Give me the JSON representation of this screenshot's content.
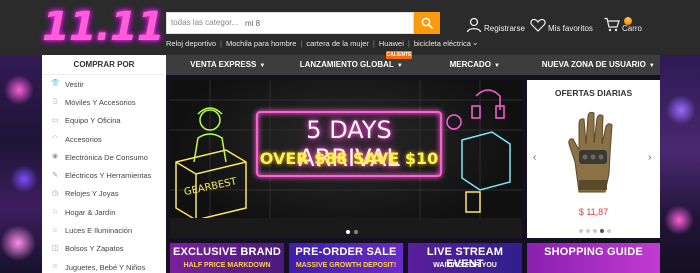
{
  "logo": {
    "text": "11.11"
  },
  "search": {
    "category": "todas las categor...",
    "value": "mi 8",
    "button_icon": "search-icon"
  },
  "hot_words": [
    "Reloj deportivo",
    "Mochila para hombre",
    "cartera de la mujer",
    "Huawei",
    "bicicleta eléctrica"
  ],
  "header_actions": {
    "register": "Registrarse",
    "favorites": "Mis favoritos",
    "cart": "Carro",
    "cart_count": "0"
  },
  "categories": {
    "title": "COMPRAR POR",
    "items": [
      "Vestir",
      "Móviles Y Accesorios",
      "Equipo Y Oficina",
      "Accesorios",
      "Electrónica De Consumo",
      "Eléctricos Y Herramientas",
      "Relojes Y Joyas",
      "Hogar & Jardín",
      "Luces E Iluminación",
      "Bolsos Y Zapatos",
      "Juguetes, Bebé Y Niños"
    ]
  },
  "nav": {
    "items": [
      "VENTA EXPRESS",
      "LANZAMIENTO GLOBAL",
      "MERCADO",
      "NUEVA ZONA DE USUARIO"
    ],
    "hot_tag": "CALIENTE"
  },
  "banner": {
    "line1": "5 DAYS ARRIVAL",
    "line2": "OVER $88 SAVE $10",
    "box_label": "GEARBEST"
  },
  "deals": {
    "title": "OFERTAS DIARIAS",
    "price": "$ 11,87"
  },
  "tiles": [
    {
      "title": "EXCLUSIVE BRAND",
      "sub": "HALF PRICE MARKDOWN"
    },
    {
      "title": "PRE-ORDER SALE",
      "sub": "MASSIVE GROWTH DEPOSIT!"
    },
    {
      "title": "LIVE STREAM EVENT",
      "sub": "WAITING FOR YOU"
    },
    {
      "title": "SHOPPING GUIDE",
      "sub": ""
    }
  ],
  "colors": {
    "accent": "#fb9a0b",
    "header_bg": "#2b2b2b",
    "nav_bg": "#3d3d3d",
    "price": "#e33333",
    "hot_tag": "#ff6b00"
  }
}
